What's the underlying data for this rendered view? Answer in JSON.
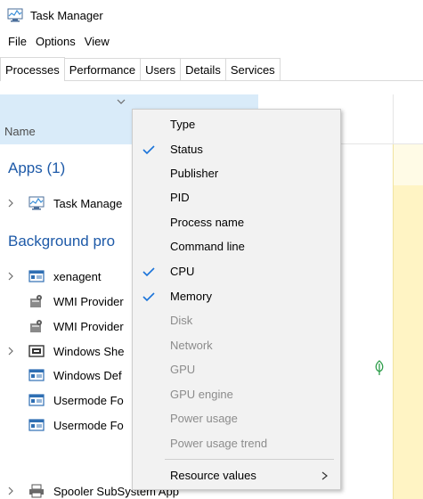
{
  "window": {
    "title": "Task Manager",
    "icon": "task-manager-icon"
  },
  "menubar": {
    "items": [
      "File",
      "Options",
      "View"
    ]
  },
  "tabs": [
    {
      "label": "Processes",
      "active": true
    },
    {
      "label": "Performance",
      "active": false
    },
    {
      "label": "Users",
      "active": false
    },
    {
      "label": "Details",
      "active": false
    },
    {
      "label": "Services",
      "active": false
    }
  ],
  "columns": {
    "name_label": "Name"
  },
  "groups": {
    "apps": "Apps (1)",
    "background": "Background pro"
  },
  "processes": [
    {
      "name": "Task Manage",
      "icon": "task-manager-icon",
      "expandable": true
    },
    {
      "name": "xenagent",
      "icon": "app-window-icon",
      "expandable": true
    },
    {
      "name": "WMI Provider",
      "icon": "wmi-provider-icon",
      "expandable": false
    },
    {
      "name": "WMI Provider",
      "icon": "wmi-provider-icon",
      "expandable": false
    },
    {
      "name": "Windows She",
      "icon": "shell-window-icon",
      "expandable": true
    },
    {
      "name": "Windows Def",
      "icon": "app-window-icon",
      "expandable": false
    },
    {
      "name": "Usermode Fo",
      "icon": "app-window-icon",
      "expandable": false
    },
    {
      "name": "Usermode Fo",
      "icon": "app-window-icon",
      "expandable": false
    },
    {
      "name": "Spooler SubSystem App",
      "icon": "printer-icon",
      "expandable": true
    }
  ],
  "context_menu": {
    "items": [
      {
        "label": "Type",
        "checked": false,
        "enabled": true
      },
      {
        "label": "Status",
        "checked": true,
        "enabled": true
      },
      {
        "label": "Publisher",
        "checked": false,
        "enabled": true
      },
      {
        "label": "PID",
        "checked": false,
        "enabled": true
      },
      {
        "label": "Process name",
        "checked": false,
        "enabled": true
      },
      {
        "label": "Command line",
        "checked": false,
        "enabled": true
      },
      {
        "label": "CPU",
        "checked": true,
        "enabled": true
      },
      {
        "label": "Memory",
        "checked": true,
        "enabled": true
      },
      {
        "label": "Disk",
        "checked": false,
        "enabled": false
      },
      {
        "label": "Network",
        "checked": false,
        "enabled": false
      },
      {
        "label": "GPU",
        "checked": false,
        "enabled": false
      },
      {
        "label": "GPU engine",
        "checked": false,
        "enabled": false
      },
      {
        "label": "Power usage",
        "checked": false,
        "enabled": false
      },
      {
        "label": "Power usage trend",
        "checked": false,
        "enabled": false
      }
    ],
    "resource_values": {
      "label": "Resource values",
      "arrow": ">"
    }
  },
  "colors": {
    "accent_check": "#1a73d9",
    "header_highlight": "#d9ebf9",
    "group_heading": "#1e5aa8",
    "cpu_column": "#fff4c4"
  }
}
